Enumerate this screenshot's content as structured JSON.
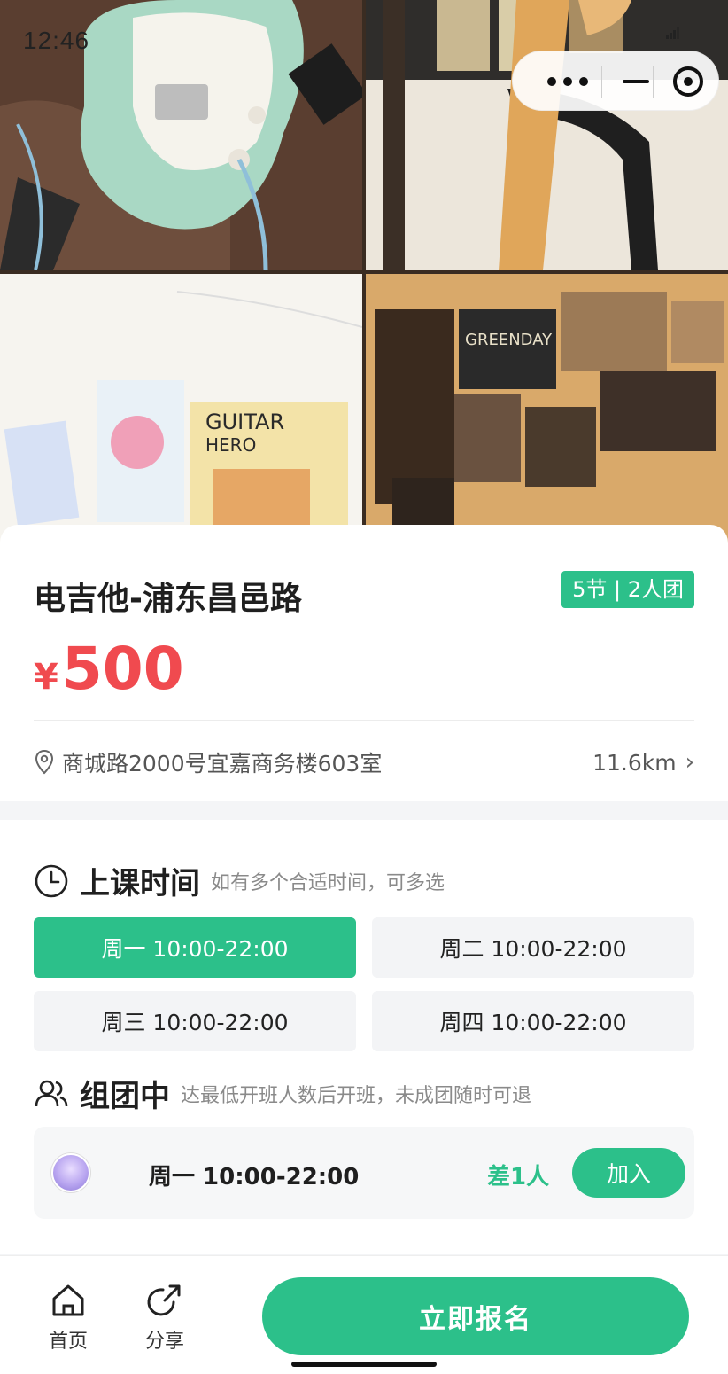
{
  "status_bar": {
    "time": "12:46"
  },
  "capsule": {
    "more_icon": "more-icon",
    "minimize_icon": "minimize-icon",
    "close_icon": "target-icon"
  },
  "course": {
    "title": "电吉他-浦东昌邑路",
    "badge": "5节 | 2人团",
    "currency": "¥",
    "price": "500",
    "address": "商城路2000号宜嘉商务楼603室",
    "distance": "11.6km",
    "distance_chevron": "›"
  },
  "schedule": {
    "title": "上课时间",
    "subtitle": "如有多个合适时间，可多选",
    "slots": [
      {
        "label": "周一 10:00-22:00",
        "selected": true
      },
      {
        "label": "周二 10:00-22:00",
        "selected": false
      },
      {
        "label": "周三 10:00-22:00",
        "selected": false
      },
      {
        "label": "周四 10:00-22:00",
        "selected": false
      }
    ]
  },
  "group": {
    "title": "组团中",
    "subtitle": "达最低开班人数后开班，未成团随时可退",
    "items": [
      {
        "time": "周一 10:00-22:00",
        "diff": "差1人",
        "join_label": "加入"
      }
    ]
  },
  "bottom_bar": {
    "home_label": "首页",
    "share_label": "分享",
    "cta_label": "立即报名"
  },
  "colors": {
    "accent": "#2cc08a",
    "price": "#f04a4f"
  }
}
